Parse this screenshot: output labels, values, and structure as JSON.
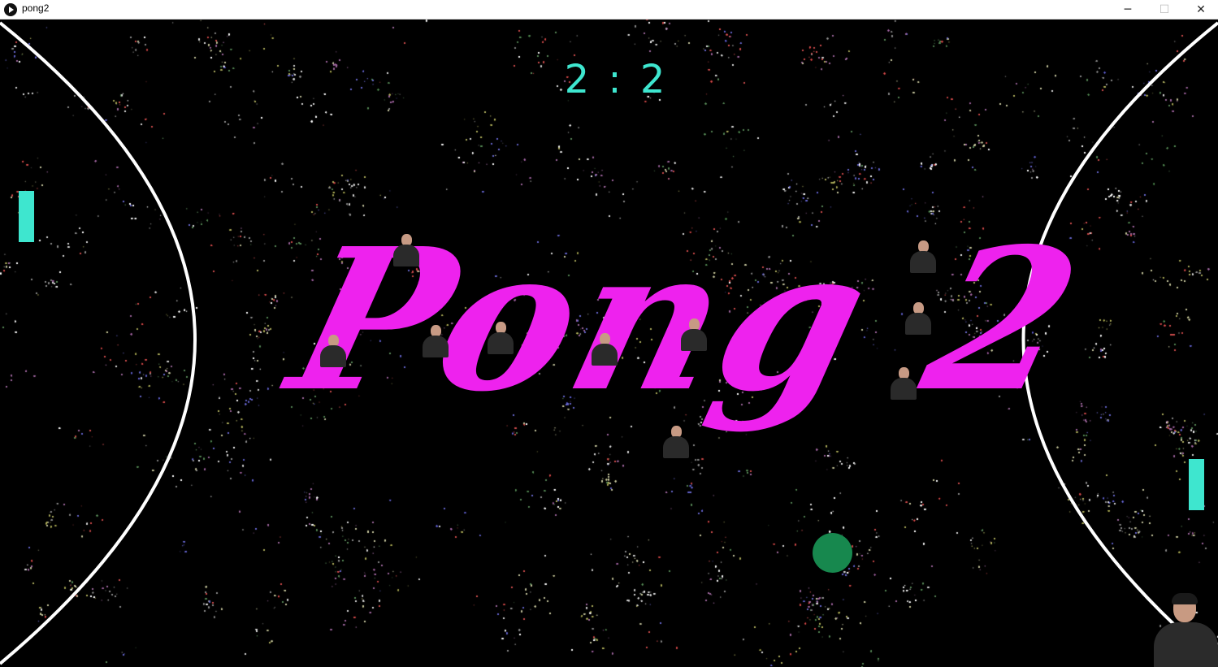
{
  "window": {
    "title": "pong2",
    "minimize_glyph": "─",
    "maximize_glyph": "☐",
    "close_glyph": "✕"
  },
  "game": {
    "score": "2 : 2",
    "title": "Pong 2",
    "colors": {
      "paddle": "#3ee6cf",
      "score": "#3ee6cf",
      "ball": "#17884e",
      "title": "#ee22ee",
      "court_line": "#ffffff",
      "background": "#000000"
    }
  }
}
